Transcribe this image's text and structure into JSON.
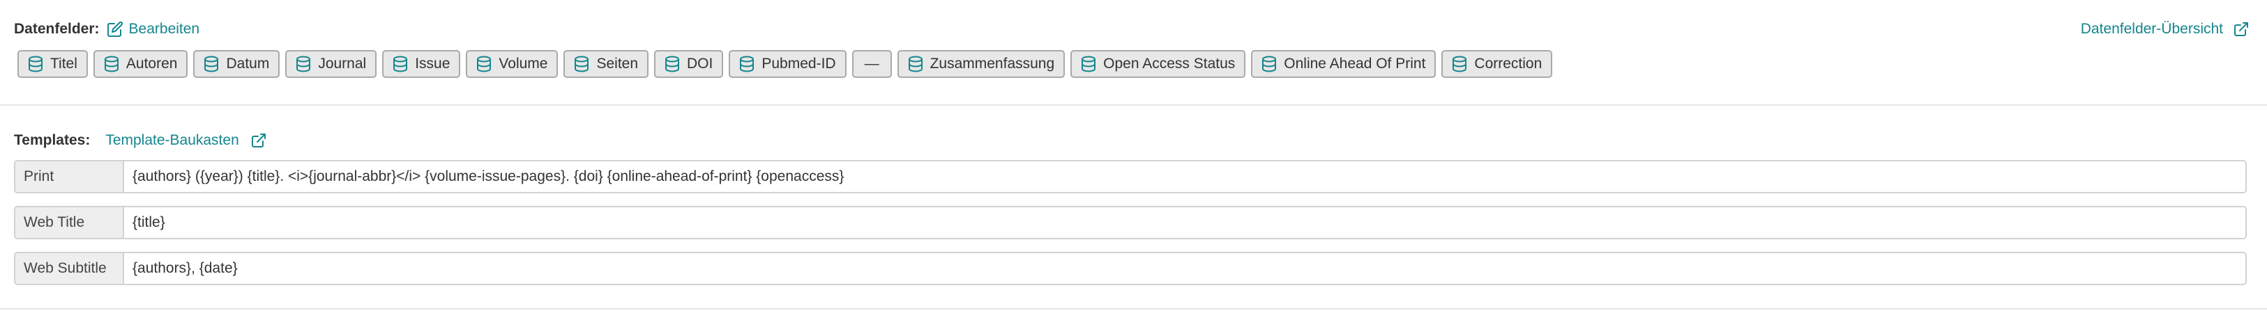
{
  "datafields": {
    "label": "Datenfelder:",
    "edit_label": "Bearbeiten",
    "overview_label": "Datenfelder-Übersicht",
    "chips": [
      {
        "label": "Titel",
        "icon": "database-icon"
      },
      {
        "label": "Autoren",
        "icon": "database-icon"
      },
      {
        "label": "Datum",
        "icon": "database-icon"
      },
      {
        "label": "Journal",
        "icon": "database-icon"
      },
      {
        "label": "Issue",
        "icon": "database-icon"
      },
      {
        "label": "Volume",
        "icon": "database-icon"
      },
      {
        "label": "Seiten",
        "icon": "database-icon"
      },
      {
        "label": "DOI",
        "icon": "database-icon"
      },
      {
        "label": "Pubmed-ID",
        "icon": "database-icon"
      },
      {
        "label": "—",
        "icon": ""
      },
      {
        "label": "Zusammenfassung",
        "icon": "database-icon"
      },
      {
        "label": "Open Access Status",
        "icon": "database-icon"
      },
      {
        "label": "Online Ahead Of Print",
        "icon": "database-icon"
      },
      {
        "label": "Correction",
        "icon": "database-icon"
      }
    ]
  },
  "templates": {
    "label": "Templates:",
    "builder_label": "Template-Baukasten",
    "rows": [
      {
        "label": "Print",
        "value": "{authors} ({year}) {title}. <i>{journal-abbr}</i> {volume-issue-pages}. {doi} {online-ahead-of-print} {openaccess}"
      },
      {
        "label": "Web Title",
        "value": "{title}"
      },
      {
        "label": "Web Subtitle",
        "value": "{authors}, {date}"
      }
    ]
  },
  "colors": {
    "accent": "#14868d",
    "chip_bg": "#e8e8e8",
    "chip_border": "#a9a9a9",
    "label_bg": "#eeeeee"
  }
}
